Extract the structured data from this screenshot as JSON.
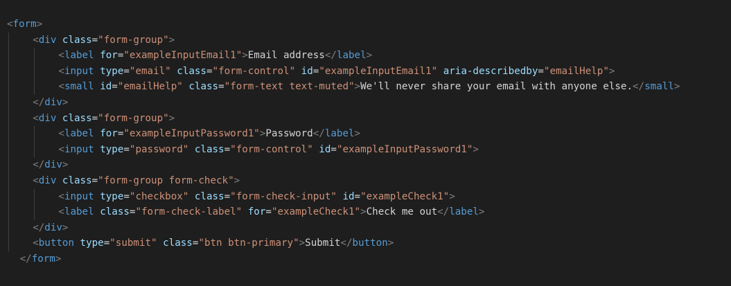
{
  "editor": {
    "lines": [
      {
        "indent": 0,
        "tokens": [
          [
            "b",
            "<"
          ],
          [
            "t",
            "form"
          ],
          [
            "b",
            ">"
          ]
        ]
      },
      {
        "indent": 1,
        "tokens": [
          [
            "b",
            "<"
          ],
          [
            "t",
            "div"
          ],
          [
            "x",
            " "
          ],
          [
            "a",
            "class"
          ],
          [
            "x",
            "="
          ],
          [
            "s",
            "\"form-group\""
          ],
          [
            "b",
            ">"
          ]
        ]
      },
      {
        "indent": 2,
        "tokens": [
          [
            "b",
            "<"
          ],
          [
            "t",
            "label"
          ],
          [
            "x",
            " "
          ],
          [
            "a",
            "for"
          ],
          [
            "x",
            "="
          ],
          [
            "s",
            "\"exampleInputEmail1\""
          ],
          [
            "b",
            ">"
          ],
          [
            "x",
            "Email address"
          ],
          [
            "b",
            "</"
          ],
          [
            "t",
            "label"
          ],
          [
            "b",
            ">"
          ]
        ]
      },
      {
        "indent": 2,
        "tokens": [
          [
            "b",
            "<"
          ],
          [
            "t",
            "input"
          ],
          [
            "x",
            " "
          ],
          [
            "a",
            "type"
          ],
          [
            "x",
            "="
          ],
          [
            "s",
            "\"email\""
          ],
          [
            "x",
            " "
          ],
          [
            "a",
            "class"
          ],
          [
            "x",
            "="
          ],
          [
            "s",
            "\"form-control\""
          ],
          [
            "x",
            " "
          ],
          [
            "a",
            "id"
          ],
          [
            "x",
            "="
          ],
          [
            "s",
            "\"exampleInputEmail1\""
          ],
          [
            "x",
            " "
          ],
          [
            "a",
            "aria-describedby"
          ],
          [
            "x",
            "="
          ],
          [
            "s",
            "\"emailHelp\""
          ],
          [
            "b",
            ">"
          ]
        ]
      },
      {
        "indent": 2,
        "tokens": [
          [
            "b",
            "<"
          ],
          [
            "t",
            "small"
          ],
          [
            "x",
            " "
          ],
          [
            "a",
            "id"
          ],
          [
            "x",
            "="
          ],
          [
            "s",
            "\"emailHelp\""
          ],
          [
            "x",
            " "
          ],
          [
            "a",
            "class"
          ],
          [
            "x",
            "="
          ],
          [
            "s",
            "\"form-text text-muted\""
          ],
          [
            "b",
            ">"
          ],
          [
            "x",
            "We'll never share your email with anyone else."
          ],
          [
            "b",
            "</"
          ],
          [
            "t",
            "small"
          ],
          [
            "b",
            ">"
          ]
        ]
      },
      {
        "indent": 1,
        "tokens": [
          [
            "b",
            "</"
          ],
          [
            "t",
            "div"
          ],
          [
            "b",
            ">"
          ]
        ]
      },
      {
        "indent": 1,
        "tokens": [
          [
            "b",
            "<"
          ],
          [
            "t",
            "div"
          ],
          [
            "x",
            " "
          ],
          [
            "a",
            "class"
          ],
          [
            "x",
            "="
          ],
          [
            "s",
            "\"form-group\""
          ],
          [
            "b",
            ">"
          ]
        ]
      },
      {
        "indent": 2,
        "tokens": [
          [
            "b",
            "<"
          ],
          [
            "t",
            "label"
          ],
          [
            "x",
            " "
          ],
          [
            "a",
            "for"
          ],
          [
            "x",
            "="
          ],
          [
            "s",
            "\"exampleInputPassword1\""
          ],
          [
            "b",
            ">"
          ],
          [
            "x",
            "Password"
          ],
          [
            "b",
            "</"
          ],
          [
            "t",
            "label"
          ],
          [
            "b",
            ">"
          ]
        ]
      },
      {
        "indent": 2,
        "tokens": [
          [
            "b",
            "<"
          ],
          [
            "t",
            "input"
          ],
          [
            "x",
            " "
          ],
          [
            "a",
            "type"
          ],
          [
            "x",
            "="
          ],
          [
            "s",
            "\"password\""
          ],
          [
            "x",
            " "
          ],
          [
            "a",
            "class"
          ],
          [
            "x",
            "="
          ],
          [
            "s",
            "\"form-control\""
          ],
          [
            "x",
            " "
          ],
          [
            "a",
            "id"
          ],
          [
            "x",
            "="
          ],
          [
            "s",
            "\"exampleInputPassword1\""
          ],
          [
            "b",
            ">"
          ]
        ]
      },
      {
        "indent": 1,
        "tokens": [
          [
            "b",
            "</"
          ],
          [
            "t",
            "div"
          ],
          [
            "b",
            ">"
          ]
        ]
      },
      {
        "indent": 1,
        "tokens": [
          [
            "b",
            "<"
          ],
          [
            "t",
            "div"
          ],
          [
            "x",
            " "
          ],
          [
            "a",
            "class"
          ],
          [
            "x",
            "="
          ],
          [
            "s",
            "\"form-group form-check\""
          ],
          [
            "b",
            ">"
          ]
        ]
      },
      {
        "indent": 2,
        "tokens": [
          [
            "b",
            "<"
          ],
          [
            "t",
            "input"
          ],
          [
            "x",
            " "
          ],
          [
            "a",
            "type"
          ],
          [
            "x",
            "="
          ],
          [
            "s",
            "\"checkbox\""
          ],
          [
            "x",
            " "
          ],
          [
            "a",
            "class"
          ],
          [
            "x",
            "="
          ],
          [
            "s",
            "\"form-check-input\""
          ],
          [
            "x",
            " "
          ],
          [
            "a",
            "id"
          ],
          [
            "x",
            "="
          ],
          [
            "s",
            "\"exampleCheck1\""
          ],
          [
            "b",
            ">"
          ]
        ]
      },
      {
        "indent": 2,
        "tokens": [
          [
            "b",
            "<"
          ],
          [
            "t",
            "label"
          ],
          [
            "x",
            " "
          ],
          [
            "a",
            "class"
          ],
          [
            "x",
            "="
          ],
          [
            "s",
            "\"form-check-label\""
          ],
          [
            "x",
            " "
          ],
          [
            "a",
            "for"
          ],
          [
            "x",
            "="
          ],
          [
            "s",
            "\"exampleCheck1\""
          ],
          [
            "b",
            ">"
          ],
          [
            "x",
            "Check me out"
          ],
          [
            "b",
            "</"
          ],
          [
            "t",
            "label"
          ],
          [
            "b",
            ">"
          ]
        ]
      },
      {
        "indent": 1,
        "tokens": [
          [
            "b",
            "</"
          ],
          [
            "t",
            "div"
          ],
          [
            "b",
            ">"
          ]
        ]
      },
      {
        "indent": 1,
        "tokens": [
          [
            "b",
            "<"
          ],
          [
            "t",
            "button"
          ],
          [
            "x",
            " "
          ],
          [
            "a",
            "type"
          ],
          [
            "x",
            "="
          ],
          [
            "s",
            "\"submit\""
          ],
          [
            "x",
            " "
          ],
          [
            "a",
            "class"
          ],
          [
            "x",
            "="
          ],
          [
            "s",
            "\"btn btn-primary\""
          ],
          [
            "b",
            ">"
          ],
          [
            "x",
            "Submit"
          ],
          [
            "b",
            "</"
          ],
          [
            "t",
            "button"
          ],
          [
            "b",
            ">"
          ]
        ]
      },
      {
        "indent": 0.5,
        "tokens": [
          [
            "b",
            "</"
          ],
          [
            "t",
            "form"
          ],
          [
            "b",
            ">"
          ]
        ]
      }
    ]
  }
}
